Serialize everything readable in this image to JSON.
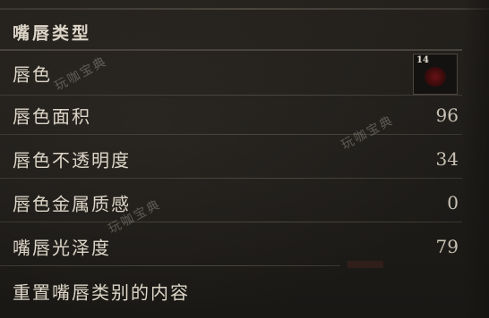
{
  "header": {
    "title": "嘴唇类型"
  },
  "rows": [
    {
      "label": "唇色",
      "swatch_number": "14",
      "swatch_color": "#6a1214"
    },
    {
      "label": "唇色面积",
      "value": "96"
    },
    {
      "label": "唇色不透明度",
      "value": "34"
    },
    {
      "label": "唇色金属质感",
      "value": "0"
    },
    {
      "label": "嘴唇光泽度",
      "value": "79"
    },
    {
      "label": "重置嘴唇类别的内容"
    }
  ],
  "watermark": "玩咖宝典"
}
